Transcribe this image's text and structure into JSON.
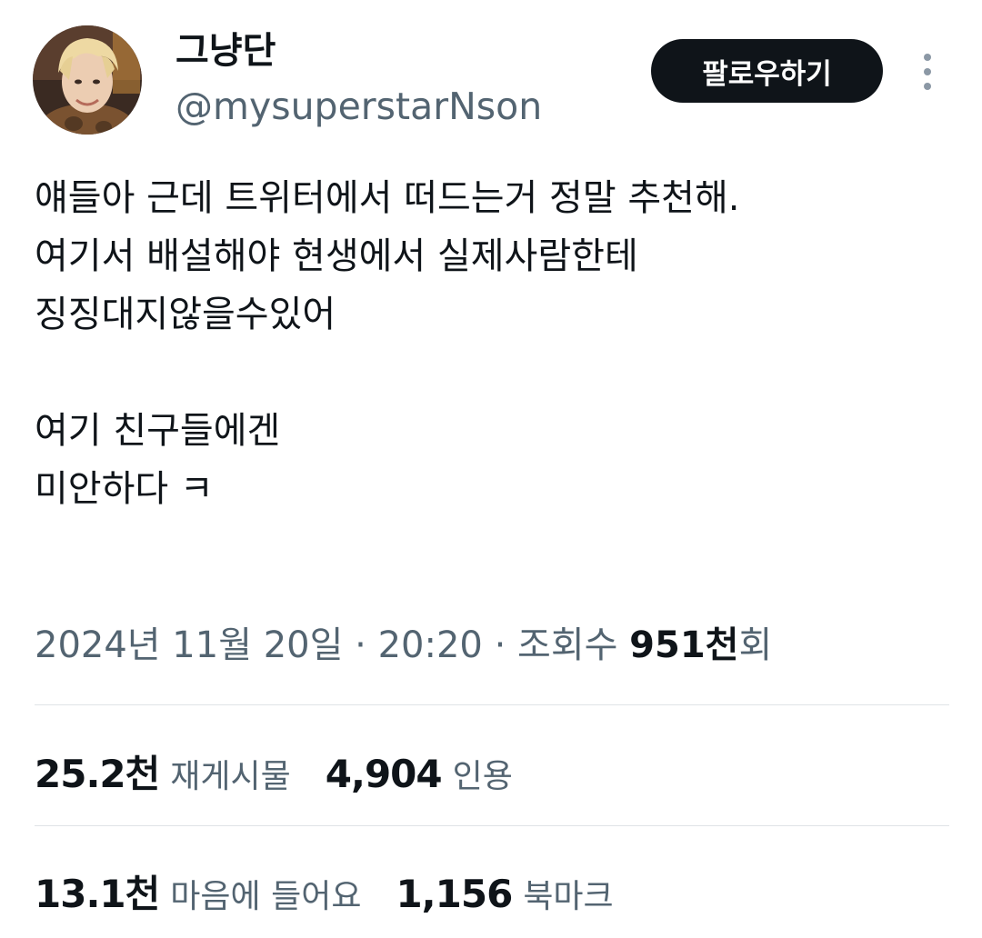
{
  "profile": {
    "display_name": "그냥단",
    "handle": "@mysuperstarNson",
    "avatar_alt": "avatar"
  },
  "actions": {
    "follow_label": "팔로우하기",
    "more_icon": "more-vertical-icon"
  },
  "tweet": {
    "text": "얘들아 근데 트위터에서 떠드는거 정말 추천해.\n여기서 배설해야 현생에서 실제사람한테\n징징대지않을수있어\n\n여기 친구들에겐\n미안하다 ㅋ"
  },
  "meta": {
    "date": "2024년 11월 20일",
    "separator1": " · ",
    "time": "20:20",
    "separator2": " · ",
    "views_label": "조회수 ",
    "views_count": "951천",
    "views_suffix": "회"
  },
  "stats": {
    "row1": [
      {
        "value": "25.2천",
        "label": "재게시물"
      },
      {
        "value": "4,904",
        "label": "인용"
      }
    ],
    "row2": [
      {
        "value": "13.1천",
        "label": "마음에 들어요"
      },
      {
        "value": "1,156",
        "label": "북마크"
      }
    ]
  },
  "colors": {
    "text_primary": "#0f1419",
    "text_secondary": "#536471",
    "button_bg": "#0f1419",
    "divider": "#dfe3e6"
  }
}
